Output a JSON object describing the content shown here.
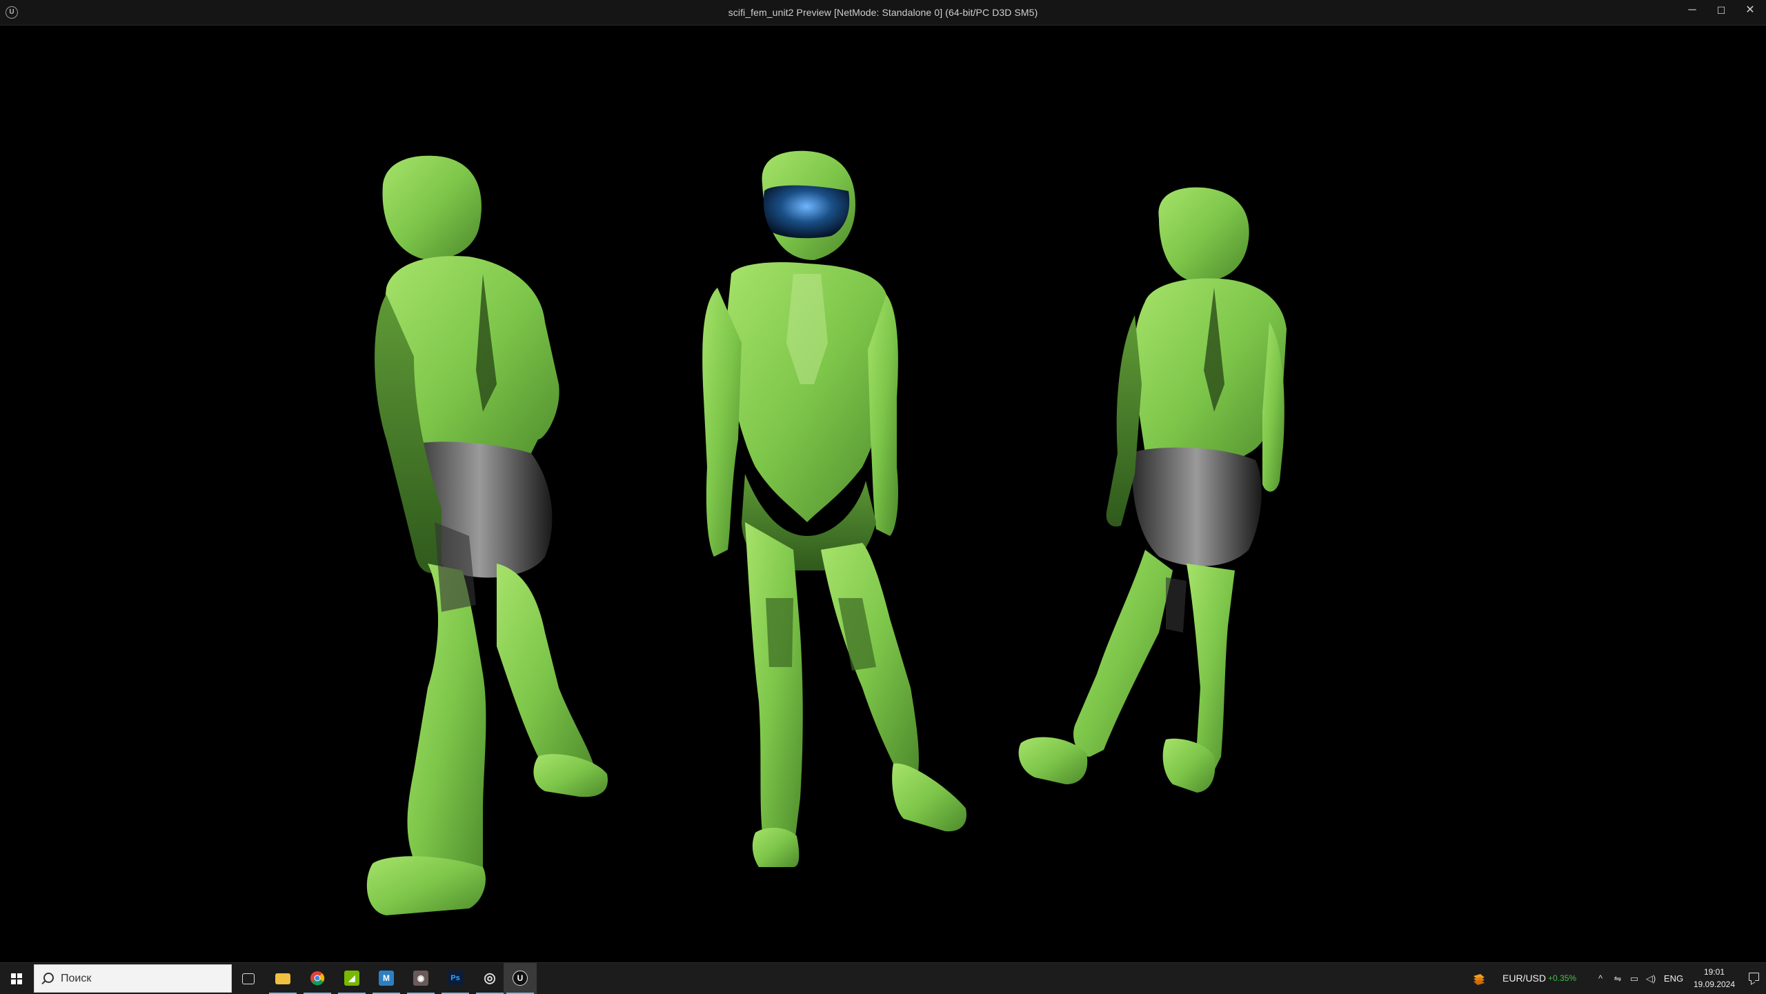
{
  "window": {
    "title": "scifi_fem_unit2 Preview [NetMode: Standalone 0]  (64-bit/PC D3D SM5)",
    "logo_text": "U",
    "minimize_glyph": "─",
    "maximize_glyph": "☐",
    "close_glyph": "✕"
  },
  "viewport": {
    "background": "#000000",
    "figures": [
      {
        "name": "figure-left",
        "pose": "back-left view"
      },
      {
        "name": "figure-center",
        "pose": "front view"
      },
      {
        "name": "figure-right",
        "pose": "back-right view"
      }
    ],
    "armor_color": "#7dc64a",
    "visor_color": "#1a4f86"
  },
  "taskbar": {
    "search": {
      "placeholder": "Поиск",
      "value": ""
    },
    "apps": [
      {
        "id": "task-view",
        "icon": "task-view-icon",
        "glyph": "⧉",
        "color": "#1c1c1c"
      },
      {
        "id": "file-explorer",
        "icon": "folder-icon",
        "glyph": "",
        "color": "#f0c040"
      },
      {
        "id": "chrome",
        "icon": "chrome-icon",
        "glyph": "",
        "color": "#db4437"
      },
      {
        "id": "nvidia",
        "icon": "nvidia-icon",
        "glyph": "◢",
        "color": "#76b900"
      },
      {
        "id": "maxon",
        "icon": "m-app-icon",
        "glyph": "M",
        "color": "#2d7fc1"
      },
      {
        "id": "media-app",
        "icon": "media-icon",
        "glyph": "◉",
        "color": "#6a5a5a"
      },
      {
        "id": "photoshop",
        "icon": "photoshop-icon",
        "glyph": "Ps",
        "color": "#0c1d3a"
      },
      {
        "id": "steam-like",
        "icon": "game-launcher-icon",
        "glyph": "◎",
        "color": "#2b2b2b"
      },
      {
        "id": "unreal",
        "icon": "unreal-engine-icon",
        "glyph": "U",
        "color": "#111111"
      }
    ],
    "tray": {
      "currency_pair": "EUR/USD",
      "currency_change": "+0.35%",
      "chevron": "^",
      "icons": [
        "usb-icon",
        "network-icon",
        "volume-icon"
      ],
      "language": "ENG",
      "time": "19:01",
      "date": "19.09.2024"
    }
  }
}
